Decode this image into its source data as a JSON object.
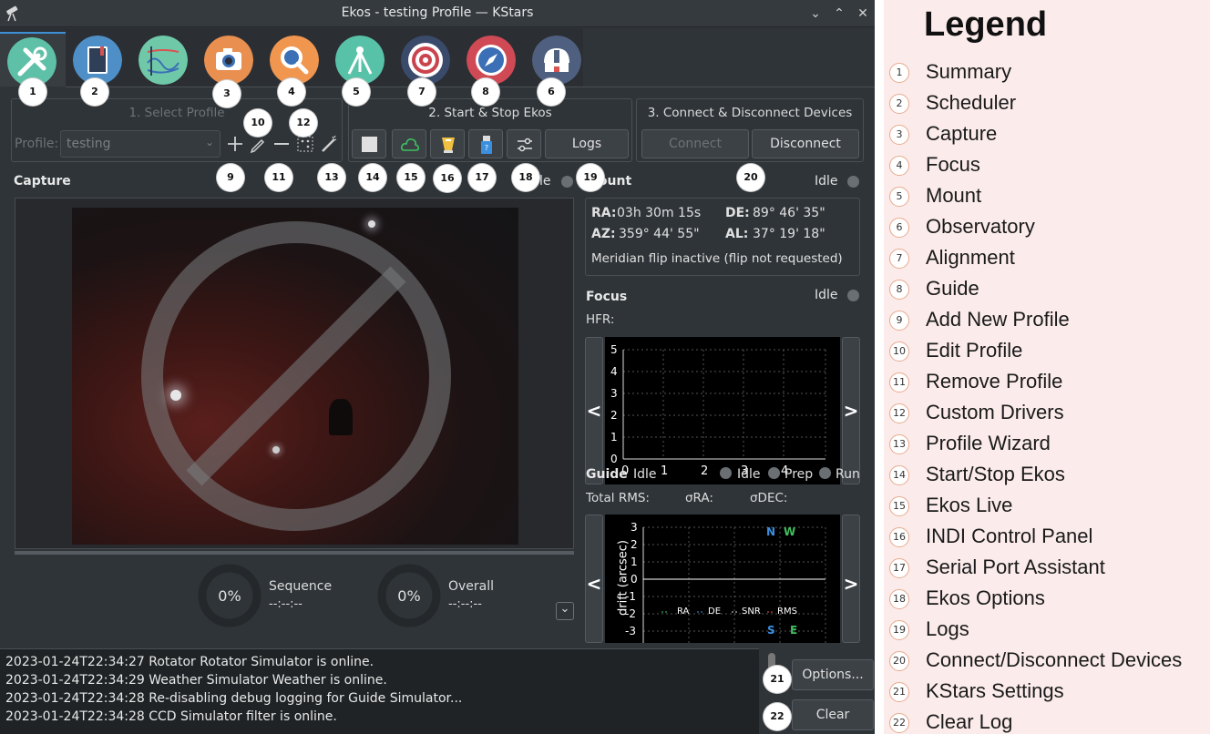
{
  "window": {
    "title": "Ekos - testing Profile — KStars"
  },
  "modules": [
    {
      "name": "summary",
      "color": "#5fc0a8"
    },
    {
      "name": "scheduler",
      "color": "#4f8fc7"
    },
    {
      "name": "analyze",
      "color": "#6fc9a9"
    },
    {
      "name": "capture",
      "color": "#e98f4f"
    },
    {
      "name": "focus",
      "color": "#f0964f"
    },
    {
      "name": "mount",
      "color": "#58c2a8"
    },
    {
      "name": "alignment",
      "color": "#c9444f"
    },
    {
      "name": "guide",
      "color": "#cf4a55"
    },
    {
      "name": "observatory",
      "color": "#4f5f7f"
    }
  ],
  "badges": {
    "b1": "1",
    "b2": "2",
    "b3": "3",
    "b4": "4",
    "b5": "5",
    "b6": "6",
    "b7": "7",
    "b8": "8",
    "b9": "9",
    "b10": "10",
    "b11": "11",
    "b12": "12",
    "b13": "13",
    "b14": "14",
    "b15": "15",
    "b16": "16",
    "b17": "17",
    "b18": "18",
    "b19": "19",
    "b20": "20",
    "b21": "21",
    "b22": "22"
  },
  "profile": {
    "group_title": "1. Select Profile",
    "label": "Profile:",
    "value": "testing"
  },
  "start_stop": {
    "group_title": "2. Start & Stop Ekos",
    "logs_label": "Logs"
  },
  "connect": {
    "group_title": "3. Connect & Disconnect Devices",
    "connect_label": "Connect",
    "disconnect_label": "Disconnect"
  },
  "capture": {
    "title": "Capture",
    "status": "Idle",
    "sequence_pct": "0%",
    "sequence_label": "Sequence",
    "sequence_time": "--:--:--",
    "overall_pct": "0%",
    "overall_label": "Overall",
    "overall_time": "--:--:--",
    "progress": 0
  },
  "mount": {
    "title": "Mount",
    "status": "Idle",
    "ra_label": "RA:",
    "ra_value": "03h 30m 15s",
    "de_label": "DE:",
    "de_value": "89° 46' 35\"",
    "az_label": "AZ:",
    "az_value": "359° 44' 55\"",
    "al_label": "AL:",
    "al_value": "37° 19' 18\"",
    "meridian": "Meridian flip inactive (flip not requested)"
  },
  "focus": {
    "title": "Focus",
    "status": "Idle",
    "hfr_label": "HFR:",
    "y_ticks": [
      "5",
      "4",
      "3",
      "2",
      "1",
      "0"
    ],
    "x_ticks": [
      "0",
      "1",
      "2",
      "3",
      "4"
    ],
    "prev": "<",
    "next": ">"
  },
  "guide": {
    "title": "Guide",
    "status": "Idle",
    "total_rms": "Total RMS:",
    "sigma_ra": "σRA:",
    "sigma_dec": "σDEC:",
    "ylabel": "drift (arcsec)",
    "y_ticks": [
      "3",
      "2",
      "1",
      "0",
      "-1",
      "-2",
      "-3"
    ],
    "compass": {
      "n": "N",
      "w": "W",
      "s": "S",
      "e": "E"
    },
    "legend": [
      "RA",
      "DE",
      "SNR",
      "RMS"
    ],
    "prev": "<",
    "next": ">"
  },
  "pipeline": {
    "idle": "Idle",
    "prep": "Prep",
    "run": "Run"
  },
  "log": {
    "lines": [
      "2023-01-24T22:34:27 Rotator Rotator Simulator is online.",
      "2023-01-24T22:34:29 Weather Simulator Weather is online.",
      "2023-01-24T22:34:28 Re-disabling debug logging for Guide Simulator...",
      "2023-01-24T22:34:28 CCD Simulator filter is online."
    ],
    "options_label": "Options...",
    "clear_label": "Clear"
  },
  "legend": {
    "title": "Legend",
    "items": [
      {
        "num": "1",
        "label": "Summary"
      },
      {
        "num": "2",
        "label": "Scheduler"
      },
      {
        "num": "3",
        "label": "Capture"
      },
      {
        "num": "4",
        "label": "Focus"
      },
      {
        "num": "5",
        "label": "Mount"
      },
      {
        "num": "6",
        "label": "Observatory"
      },
      {
        "num": "7",
        "label": "Alignment"
      },
      {
        "num": "8",
        "label": "Guide"
      },
      {
        "num": "9",
        "label": "Add New Profile"
      },
      {
        "num": "10",
        "label": "Edit Profile"
      },
      {
        "num": "11",
        "label": "Remove Profile"
      },
      {
        "num": "12",
        "label": "Custom Drivers"
      },
      {
        "num": "13",
        "label": "Profile Wizard"
      },
      {
        "num": "14",
        "label": "Start/Stop Ekos"
      },
      {
        "num": "15",
        "label": "Ekos Live"
      },
      {
        "num": "16",
        "label": "INDI Control Panel"
      },
      {
        "num": "17",
        "label": "Serial Port Assistant"
      },
      {
        "num": "18",
        "label": "Ekos Options"
      },
      {
        "num": "19",
        "label": "Logs"
      },
      {
        "num": "20",
        "label": "Connect/Disconnect Devices"
      },
      {
        "num": "21",
        "label": "KStars Settings"
      },
      {
        "num": "22",
        "label": "Clear Log"
      }
    ]
  }
}
